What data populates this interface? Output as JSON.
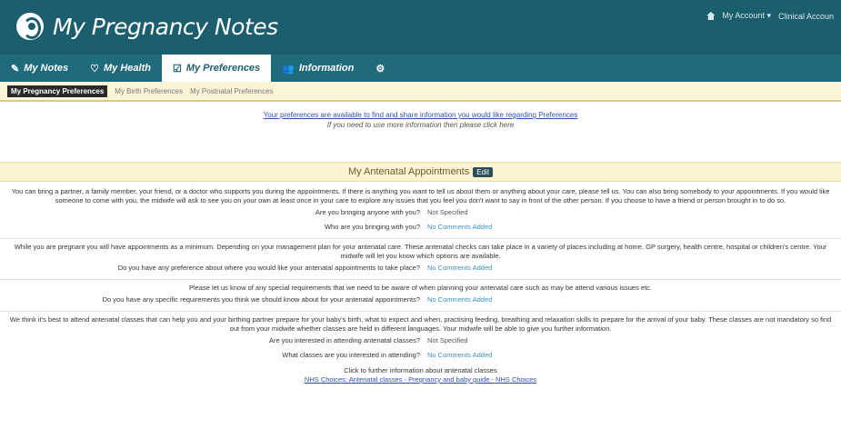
{
  "app": {
    "title": "My Pregnancy Notes"
  },
  "top_right": {
    "account": "My Account ▾",
    "clinical": "Clinical Accoun"
  },
  "nav": {
    "items": [
      {
        "label": "My Notes",
        "icon": "✎"
      },
      {
        "label": "My Health",
        "icon": "♡"
      },
      {
        "label": "My Preferences",
        "icon": "☑"
      },
      {
        "label": "Information",
        "icon": "👥"
      }
    ],
    "settings_icon": "⚙"
  },
  "subnav": {
    "active": "My Pregnancy Preferences",
    "items": [
      "My Birth Preferences",
      "My Postnatal Preferences"
    ]
  },
  "intro": {
    "link": "Your preferences are available to find and share information you would like regarding Preferences",
    "note": "If you need to use more information then please click here"
  },
  "section": {
    "title": "My Antenatal Appointments",
    "badge": "Edit"
  },
  "block1": {
    "para": "You can bring a partner, a family member, your friend, or a doctor who supports you during the appointments. If there is anything you want to tell us about them or anything about your care, please tell us. You can also bring somebody to your appointments. If you would like someone to come with you, the midwife will ask to see you on your own at least once in your care to explore any issues that you feel you don't want to say in front of the other person. If you choose to have a friend or person brought in to do so.",
    "rows": [
      {
        "q": "Are you bringing anyone with you?",
        "a": "Not Specified",
        "style": "plain"
      },
      {
        "q": "Who are you bringing with you?",
        "a": "No Comments Added",
        "style": "link"
      }
    ]
  },
  "block2": {
    "para": "While you are pregnant you will have appointments as a minimum. Depending on your management plan for your antenatal care. These antenatal checks can take place in a variety of places including at home, GP surgery, health centre, hospital or children's centre. Your midwife will let you know which options are available.",
    "rows": [
      {
        "q": "Do you have any preference about where you would like your antenatal appointments to take place?",
        "a": "No Comments Added",
        "style": "link"
      }
    ]
  },
  "block3": {
    "para": "Please let us know of any special requirements that we need to be aware of when planning your antenatal care such as may be attend various issues etc.",
    "rows": [
      {
        "q": "Do you have any specific requirements you think we should know about for your antenatal appointments?",
        "a": "No Comments Added",
        "style": "link"
      }
    ]
  },
  "block4": {
    "para": "We think it's best to attend antenatal classes that can help you and your birthing partner prepare for your baby's birth, what to expect and when, practising feeding, breathing and relaxation skills to prepare for the arrival of your baby. These classes are not mandatory so find out from your midwife whether classes are held in different languages. Your midwife will be able to give you further information.",
    "rows": [
      {
        "q": "Are you interested in attending antenatal classes?",
        "a": "Not Specified",
        "style": "plain"
      },
      {
        "q": "What classes are you interested in attending?",
        "a": "No Comments Added",
        "style": "link"
      }
    ]
  },
  "footer": {
    "line1": "Click to further information about antenatal classes",
    "link": "NHS Choices: Antenatal classes - Pregnancy and baby guide - NHS Choices"
  }
}
